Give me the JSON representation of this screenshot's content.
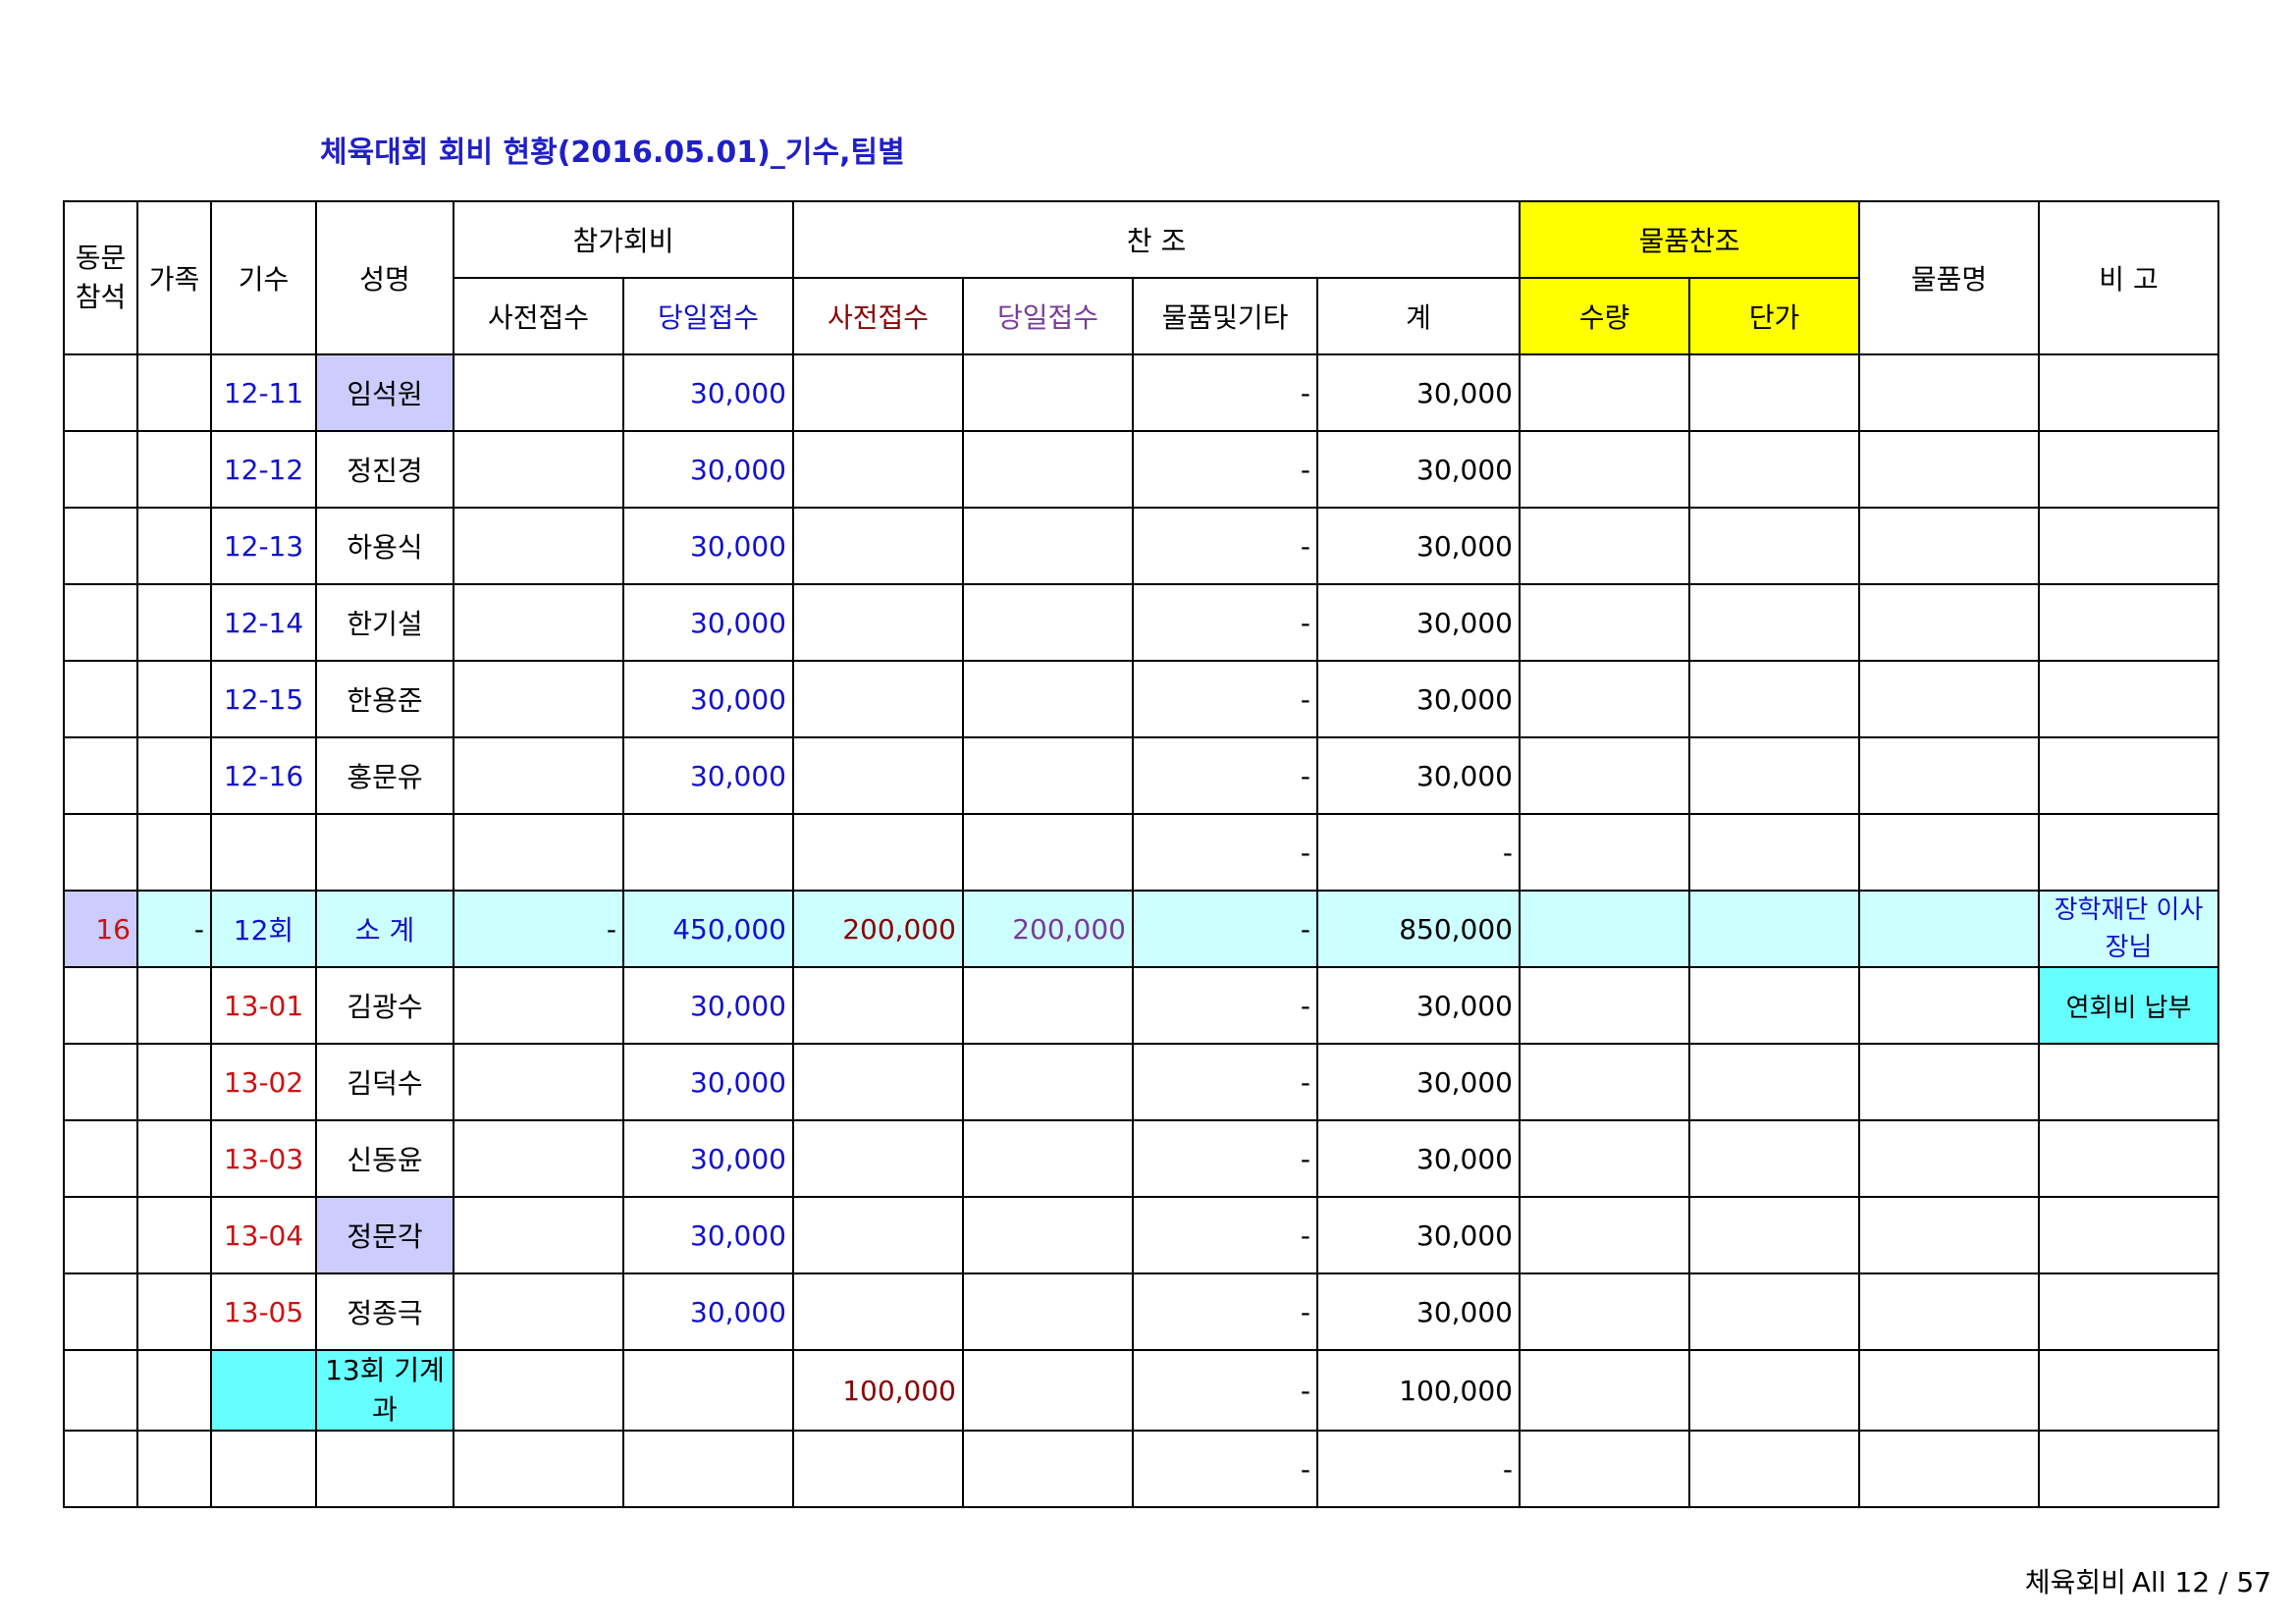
{
  "title": "체육대회 회비 현황(2016.05.01)_기수,팀별",
  "header": {
    "col1": "동문\n참석",
    "col2": "가족",
    "col3": "기수",
    "col4": "성명",
    "group_fee": "참가회비",
    "group_support": "찬 조",
    "group_goods": "물품찬조",
    "goods_name": "물품명",
    "remark": "비 고",
    "fee_pre": "사전접수",
    "fee_day": "당일접수",
    "sup_pre": "사전접수",
    "sup_day": "당일접수",
    "sup_goods": "물품및기타",
    "sup_total": "계",
    "qty": "수량",
    "price": "단가"
  },
  "rows": [
    {
      "gisu": "12-11",
      "name": "임석원",
      "fee_day": "30,000",
      "goods": "-",
      "total": "30,000"
    },
    {
      "gisu": "12-12",
      "name": "정진경",
      "fee_day": "30,000",
      "goods": "-",
      "total": "30,000"
    },
    {
      "gisu": "12-13",
      "name": "하용식",
      "fee_day": "30,000",
      "goods": "-",
      "total": "30,000"
    },
    {
      "gisu": "12-14",
      "name": "한기설",
      "fee_day": "30,000",
      "goods": "-",
      "total": "30,000"
    },
    {
      "gisu": "12-15",
      "name": "한용준",
      "fee_day": "30,000",
      "goods": "-",
      "total": "30,000"
    },
    {
      "gisu": "12-16",
      "name": "홍문유",
      "fee_day": "30,000",
      "goods": "-",
      "total": "30,000"
    },
    {
      "goods": "-",
      "total": "-"
    },
    {
      "attend": "16",
      "family": "-",
      "gisu": "12회",
      "name": "소 계",
      "fee_pre": "-",
      "fee_day": "450,000",
      "sup_pre": "200,000",
      "sup_day": "200,000",
      "goods": "-",
      "total": "850,000",
      "remark": "장학재단\n이사장님"
    },
    {
      "gisu": "13-01",
      "name": "김광수",
      "fee_day": "30,000",
      "goods": "-",
      "total": "30,000",
      "remark": "연회비 납부"
    },
    {
      "gisu": "13-02",
      "name": "김덕수",
      "fee_day": "30,000",
      "goods": "-",
      "total": "30,000"
    },
    {
      "gisu": "13-03",
      "name": "신동윤",
      "fee_day": "30,000",
      "goods": "-",
      "total": "30,000"
    },
    {
      "gisu": "13-04",
      "name": "정문각",
      "fee_day": "30,000",
      "goods": "-",
      "total": "30,000"
    },
    {
      "gisu": "13-05",
      "name": "정종극",
      "fee_day": "30,000",
      "goods": "-",
      "total": "30,000"
    },
    {
      "name": "13회\n기계과",
      "sup_pre": "100,000",
      "goods": "-",
      "total": "100,000"
    },
    {
      "goods": "-",
      "total": "-"
    }
  ],
  "footer": {
    "sheet": "체육회비",
    "page": "All 12 / 57"
  }
}
